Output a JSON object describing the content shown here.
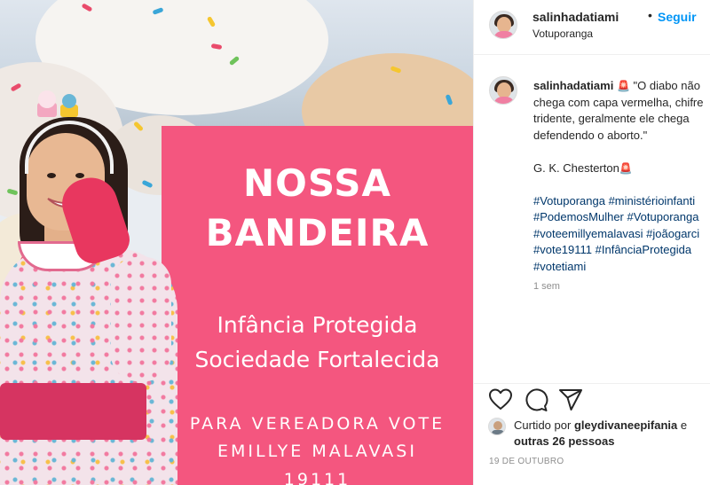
{
  "image": {
    "title_lines": [
      "NOSSA",
      "BANDEIRA"
    ],
    "subtitle_lines": [
      "Infância Protegida",
      "Sociedade Fortalecida"
    ],
    "vote_lines": [
      "PARA VEREADORA VOTE",
      "EMILLYE MALAVASI",
      "19111"
    ],
    "colors": {
      "panel": "#f4567f",
      "sash": "#d63461",
      "glove": "#e8375f"
    }
  },
  "header": {
    "username": "salinhadatiami",
    "separator": "•",
    "follow_label": "Seguir",
    "location": "Votuporanga"
  },
  "caption": {
    "username": "salinhadatiami",
    "siren_icon": "🚨",
    "quote_line_1": "\"O diabo não",
    "quote_line_2": "chega com capa vermelha, chifre",
    "quote_line_3": "tridente, geralmente ele chega",
    "quote_line_4": "defendendo o aborto.\"",
    "author": "G. K. Chesterton",
    "hashtags": [
      "#Votuporanga #ministérioinfanti",
      "#PodemosMulher #Votuporanga",
      "#voteemillyemalavasi #joãogarci",
      "#vote19111 #InfânciaProtegida",
      "#votetiami"
    ],
    "time_ago": "1 sem"
  },
  "actions": {
    "icons": [
      "heart-icon",
      "comment-icon",
      "share-icon"
    ],
    "liked_prefix": "Curtido por",
    "liked_user": "gleydivaneepifania",
    "liked_and": "e",
    "liked_others": "outras 26 pessoas",
    "date": "19 DE OUTUBRO"
  }
}
